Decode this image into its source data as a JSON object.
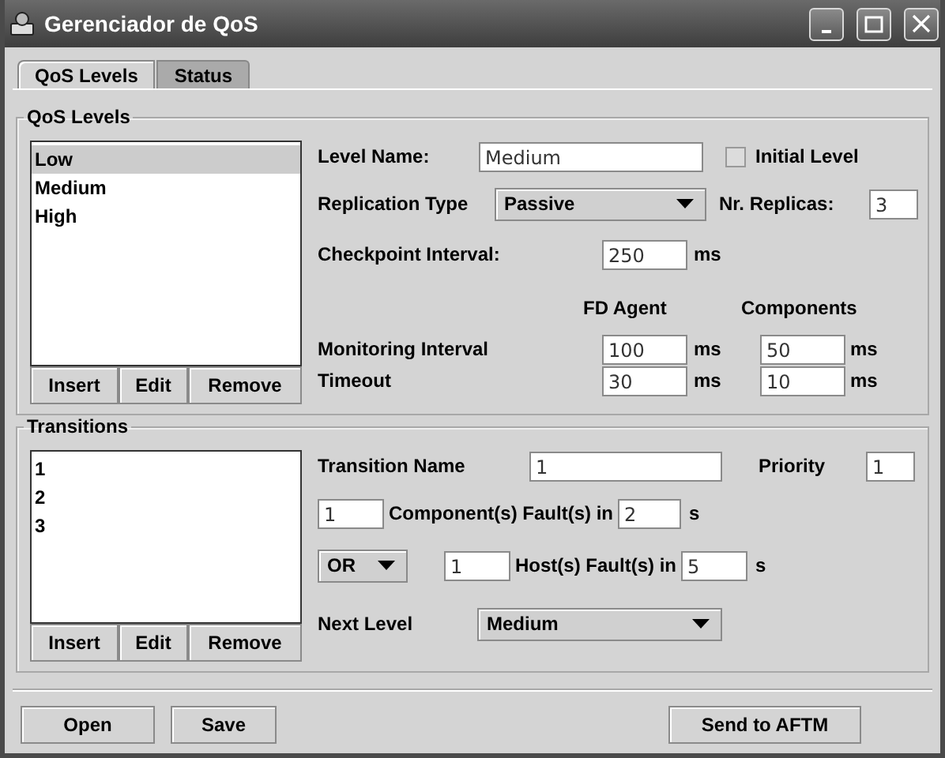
{
  "window": {
    "title": "Gerenciador de QoS"
  },
  "tabs": [
    {
      "label": "QoS Levels",
      "selected": true
    },
    {
      "label": "Status",
      "selected": false
    }
  ],
  "qos_levels": {
    "title": "QoS Levels",
    "items": [
      {
        "label": "Low",
        "selected": true
      },
      {
        "label": "Medium",
        "selected": false
      },
      {
        "label": "High",
        "selected": false
      }
    ],
    "buttons": [
      "Insert",
      "Edit",
      "Remove"
    ],
    "level_name": {
      "label": "Level Name:",
      "value": "Medium"
    },
    "initial_level": {
      "label": "Initial Level",
      "checked": false
    },
    "replication_type": {
      "label": "Replication Type",
      "value": "Passive"
    },
    "nr_replicas": {
      "label": "Nr. Replicas:",
      "value": "3"
    },
    "checkpoint_interval": {
      "label": "Checkpoint Interval:",
      "value": "250",
      "unit": "ms"
    },
    "columns": [
      "FD Agent",
      "Components"
    ],
    "rows": [
      {
        "label": "Monitoring Interval",
        "fd_agent": "100",
        "fd_agent_unit": "ms",
        "components": "50",
        "components_unit": "ms"
      },
      {
        "label": "Timeout",
        "fd_agent": "30",
        "fd_agent_unit": "ms",
        "components": "10",
        "components_unit": "ms"
      }
    ]
  },
  "transitions": {
    "title": "Transitions",
    "items": [
      {
        "label": "1",
        "selected": false
      },
      {
        "label": "2",
        "selected": false
      },
      {
        "label": "3",
        "selected": false
      }
    ],
    "buttons": [
      "Insert",
      "Edit",
      "Remove"
    ],
    "transition_name": {
      "label": "Transition Name",
      "value": "1"
    },
    "priority": {
      "label": "Priority",
      "value": "1"
    },
    "component_faults": {
      "count": "1",
      "label": "Component(s) Fault(s) in",
      "time": "2",
      "unit": "s"
    },
    "host_faults": {
      "operator": "OR",
      "count": "1",
      "label": "Host(s) Fault(s) in",
      "time": "5",
      "unit": "s"
    },
    "next_level": {
      "label": "Next Level",
      "value": "Medium"
    }
  },
  "footer": {
    "left_buttons": [
      "Open",
      "Save"
    ],
    "right_buttons": [
      "Send to AFTM"
    ]
  }
}
